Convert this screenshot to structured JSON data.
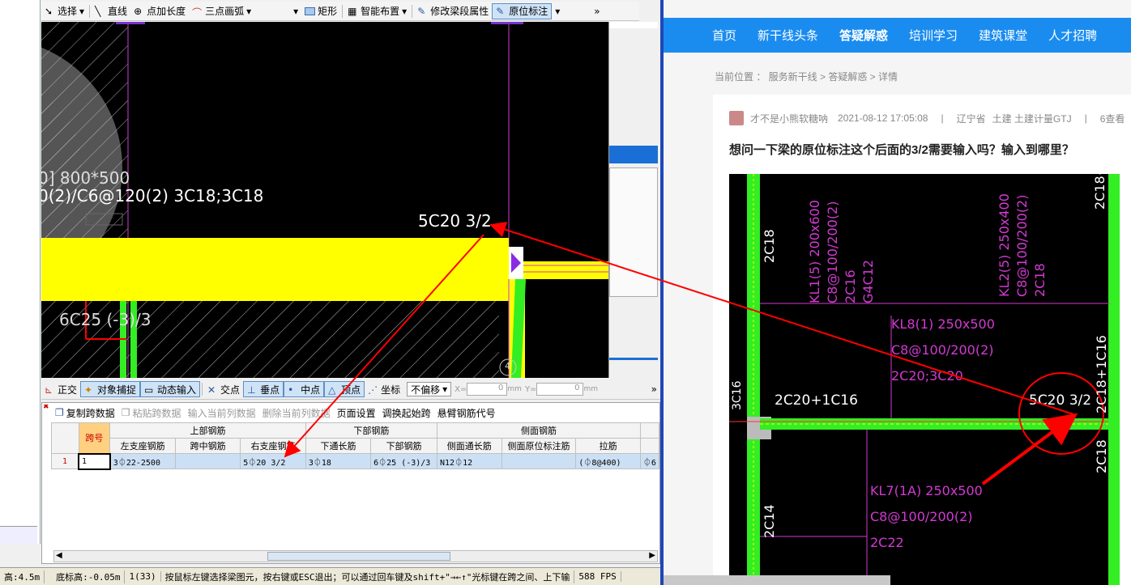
{
  "app": {
    "top_toolbar": {
      "items": [
        {
          "label": "选择",
          "icon": "cursor-icon",
          "dropdown": true
        },
        {
          "label": "直线",
          "icon": "line-icon"
        },
        {
          "label": "点加长度",
          "icon": "point-length-icon"
        },
        {
          "label": "三点画弧",
          "icon": "arc-icon",
          "dropdown": true
        },
        {
          "label": "矩形",
          "icon": "rectangle-icon"
        },
        {
          "label": "智能布置",
          "icon": "smart-layout-icon",
          "dropdown": true
        },
        {
          "label": "修改梁段属性",
          "icon": "modify-beam-icon"
        },
        {
          "label": "原位标注",
          "icon": "in-place-annotation-icon",
          "dropdown": true,
          "active": true
        }
      ],
      "overflow": "»"
    },
    "canvas": {
      "texts": [
        "0] 800*500",
        "0(2)/C6@120(2) 3C18;3C18",
        "5C20 3/2",
        "6C25 (-3)/3"
      ],
      "support_label": "4"
    },
    "snap_toolbar": {
      "items": [
        {
          "label": "正交",
          "icon": "ortho-icon"
        },
        {
          "label": "对象捕捉",
          "icon": "object-snap-icon",
          "active": true
        },
        {
          "label": "动态输入",
          "icon": "dynamic-input-icon",
          "active": true
        },
        {
          "label": "交点",
          "icon": "intersection-icon"
        },
        {
          "label": "垂点",
          "icon": "perpendicular-icon",
          "active": true
        },
        {
          "label": "中点",
          "icon": "midpoint-icon",
          "active": true
        },
        {
          "label": "顶点",
          "icon": "vertex-icon",
          "active": true
        },
        {
          "label": "坐标",
          "icon": "coordinate-icon"
        }
      ],
      "offset_select": "不偏移",
      "x_label": "X=",
      "x_value": "0",
      "x_unit": "mm",
      "y_label": "Y=",
      "y_value": "0",
      "y_unit": "mm",
      "overflow": "»"
    },
    "table_toolbar": {
      "items": [
        {
          "label": "复制跨数据",
          "enabled": true
        },
        {
          "label": "粘贴跨数据",
          "enabled": false
        },
        {
          "label": "输入当前列数据",
          "enabled": false
        },
        {
          "label": "删除当前列数据",
          "enabled": false
        },
        {
          "label": "页面设置",
          "enabled": true
        },
        {
          "label": "调换起始跨",
          "enabled": true
        },
        {
          "label": "悬臂钢筋代号",
          "enabled": true
        }
      ]
    },
    "table": {
      "group_headers": {
        "span": "跨号",
        "top": "上部钢筋",
        "bottom": "下部钢筋",
        "side": "侧面钢筋"
      },
      "columns": [
        "左支座钢筋",
        "跨中钢筋",
        "右支座钢筋",
        "下通长筋",
        "下部钢筋",
        "侧面通长筋",
        "侧面原位标注筋",
        "拉筋"
      ],
      "rows": [
        {
          "index": "1",
          "span": "1",
          "cells": [
            "3⏀22-2500",
            "",
            "5⏀20 3/2",
            "3⏀18",
            "6⏀25 (-3)/3",
            "N12⏀12",
            "",
            "(⏀8@400)"
          ],
          "extra": "⏀6"
        }
      ]
    },
    "status_bar": [
      "高:4.5m",
      "底标高:-0.05m",
      "1(33)",
      "按鼠标左键选择梁图元，按右键或ESC退出；可以通过回车键及shift+\"→←↑\"光标键在跨之间、上下输",
      "588 FPS"
    ]
  },
  "web": {
    "nav": [
      {
        "label": "首页"
      },
      {
        "label": "新干线头条"
      },
      {
        "label": "答疑解惑",
        "current": true
      },
      {
        "label": "培训学习"
      },
      {
        "label": "建筑课堂"
      },
      {
        "label": "人才招聘"
      }
    ],
    "breadcrumb": "当前位置 ： 服务新干线 > 答疑解惑 > 详情",
    "author": "才不是小熊软糖呐",
    "date": "2021-08-12 17:05:08",
    "region": "辽宁省",
    "tags": "土建 土建计量GTJ",
    "views": "6查看",
    "question": "想问一下梁的原位标注这个后面的3/2需要输入吗？输入到哪里？",
    "drawing_texts": {
      "kl1": [
        "KL1(5) 200x600",
        "C8@100/200(2)",
        "2C16",
        "G4C12"
      ],
      "kl2": [
        "KL2(5) 250x400",
        "C8@100/200(2)",
        "2C18"
      ],
      "kl8": [
        "KL8(1) 250x500",
        "C8@100/200(2)",
        "2C20;3C20"
      ],
      "kl7": [
        "KL7(1A) 250x500",
        "C8@100/200(2)",
        "2C22"
      ],
      "left_2c18": "2C18",
      "left_3c16": "3C16",
      "left_2c14": "2C14",
      "top_right": "2C18+",
      "right_mid": "2C18+1C16",
      "right_bot": "2C18",
      "beam_left": "2C20+1C16",
      "beam_right": "5C20 3/2"
    }
  },
  "colors": {
    "annotation_red": "#ff0000",
    "nav_blue": "#1a8cf0",
    "beam_yellow": "#ffff00",
    "rebar_green": "#33ee22",
    "cad_magenta": "#d23ad2"
  }
}
